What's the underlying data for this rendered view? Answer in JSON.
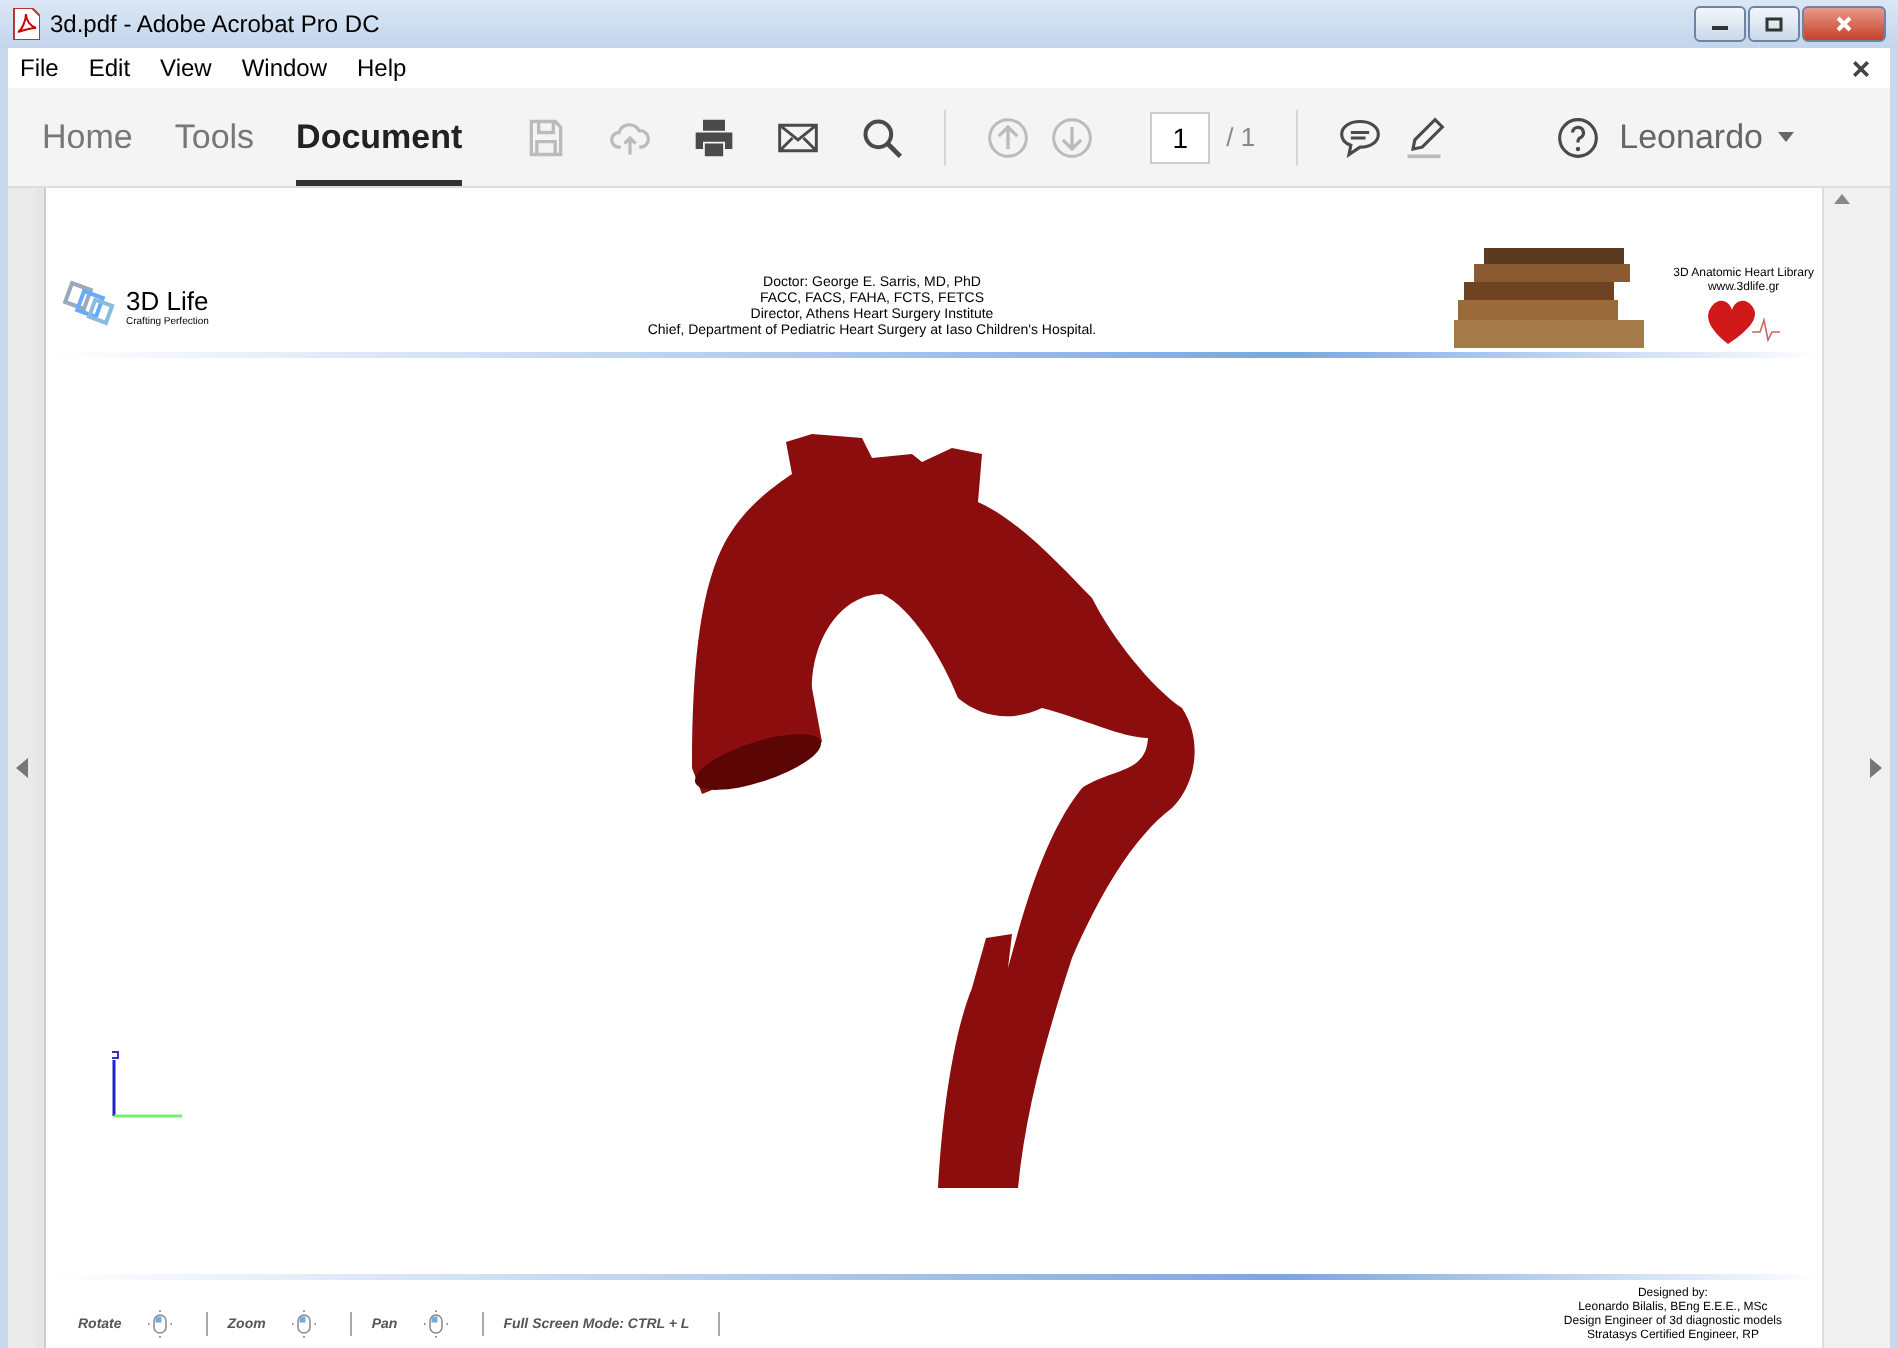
{
  "window": {
    "title": "3d.pdf - Adobe Acrobat Pro DC"
  },
  "menu": [
    "File",
    "Edit",
    "View",
    "Window",
    "Help"
  ],
  "tabs": [
    {
      "label": "Home",
      "selected": false
    },
    {
      "label": "Tools",
      "selected": false
    },
    {
      "label": "Document",
      "selected": true
    }
  ],
  "tools": [
    {
      "kind": "save",
      "disabled": true
    },
    {
      "kind": "upload",
      "disabled": true
    },
    {
      "kind": "print",
      "disabled": false
    },
    {
      "kind": "mail",
      "disabled": false
    },
    {
      "kind": "search",
      "disabled": false
    }
  ],
  "page_nav": [
    {
      "kind": "up",
      "disabled": true
    },
    {
      "kind": "down",
      "disabled": true
    }
  ],
  "page_field": {
    "value": "1",
    "total": "/ 1"
  },
  "extra_tools": [
    {
      "kind": "comment",
      "disabled": false
    },
    {
      "kind": "pen",
      "disabled": false
    }
  ],
  "user": "Leonardo",
  "document": {
    "logo_title": "3D Life",
    "logo_tagline": "Crafting Perfection",
    "doctor_lines": [
      "Doctor: George E. Sarris, MD, PhD",
      "FACC, FACS, FAHA, FCTS, FETCS",
      "Director, Athens Heart Surgery Institute",
      "Chief, Department of Pediatric Heart Surgery at Iaso Children's Hospital."
    ],
    "library_title": "3D Anatomic Heart Library",
    "library_url": "www.3dlife.gr",
    "controls": [
      {
        "label": "Rotate",
        "kind": "mouse"
      },
      {
        "label": "Zoom",
        "kind": "mouse"
      },
      {
        "label": "Pan",
        "kind": "mouse"
      },
      {
        "label": "Full Screen Mode:  CTRL + L",
        "kind": "text"
      }
    ],
    "designer_lines": [
      "Designed by:",
      "Leonardo Bilalis, BEng E.E.E., MSc",
      "Design Engineer of 3d diagnostic models",
      "Stratasys Certified Engineer, RP"
    ]
  }
}
